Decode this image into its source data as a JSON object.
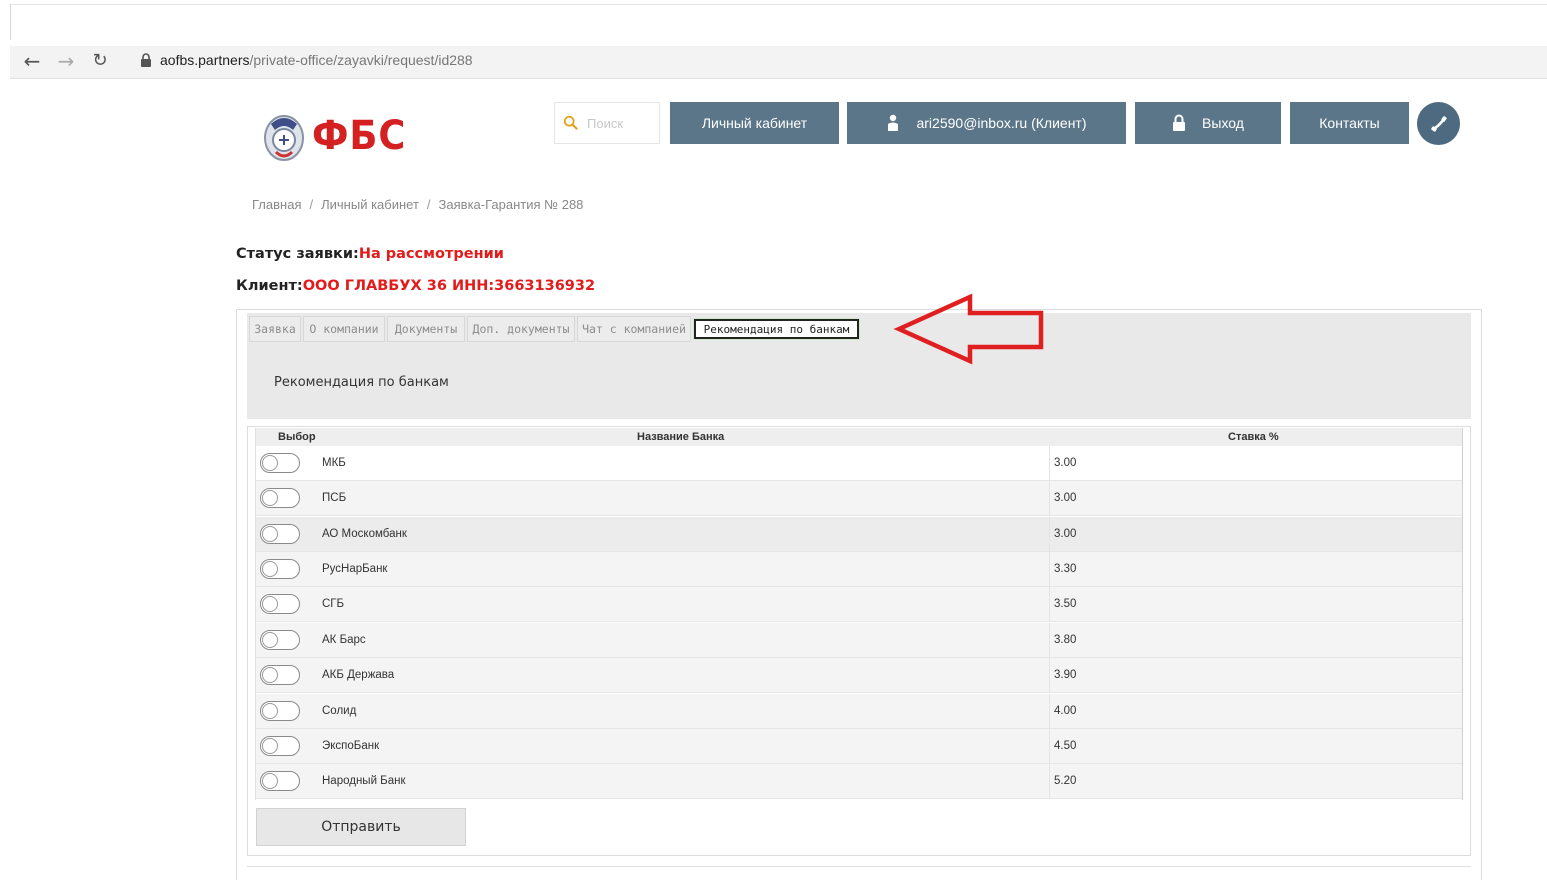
{
  "browser": {
    "url_domain": "aofbs.partners",
    "url_path": "/private-office/zayavki/request/id288"
  },
  "header": {
    "logo_text": "ФБС",
    "search_placeholder": "Поиск",
    "cabinet_label": "Личный кабинет",
    "user_label": "ari2590@inbox.ru (Клиент)",
    "logout_label": "Выход",
    "contacts_label": "Контакты"
  },
  "breadcrumb": {
    "items": [
      "Главная",
      "Личный кабинет",
      "Заявка-Гарантия № 288"
    ],
    "separator": "/"
  },
  "request": {
    "status_label": "Статус заявки:",
    "status_value": "На рассмотрении",
    "client_label": "Клиент:",
    "client_value": "ООО ГЛАВБУХ 36 ИНН:3663136932"
  },
  "tabs": [
    "Заявка",
    "О компании",
    "Документы",
    "Доп. документы",
    "Чат с компанией",
    "Рекомендация по банкам"
  ],
  "active_tab_heading": "Рекомендация по банкам",
  "table": {
    "headers": {
      "select": "Выбор",
      "bank": "Название Банка",
      "rate": "Ставка %"
    },
    "rows": [
      {
        "bank": "МКБ",
        "rate": "3.00"
      },
      {
        "bank": "ПСБ",
        "rate": "3.00"
      },
      {
        "bank": "АО Москомбанк",
        "rate": "3.00"
      },
      {
        "bank": "РусНарБанк",
        "rate": "3.30"
      },
      {
        "bank": "СГБ",
        "rate": "3.50"
      },
      {
        "bank": "АК Барс",
        "rate": "3.80"
      },
      {
        "bank": "АКБ Держава",
        "rate": "3.90"
      },
      {
        "bank": "Солид",
        "rate": "4.00"
      },
      {
        "bank": "ЭкспоБанк",
        "rate": "4.50"
      },
      {
        "bank": "Народный Банк",
        "rate": "5.20"
      }
    ]
  },
  "submit_label": "Отправить",
  "colors": {
    "accent_button": "#5b7689",
    "status_red": "#e21b1b",
    "logo_red": "#d42020",
    "arrow_red": "#e02020"
  }
}
